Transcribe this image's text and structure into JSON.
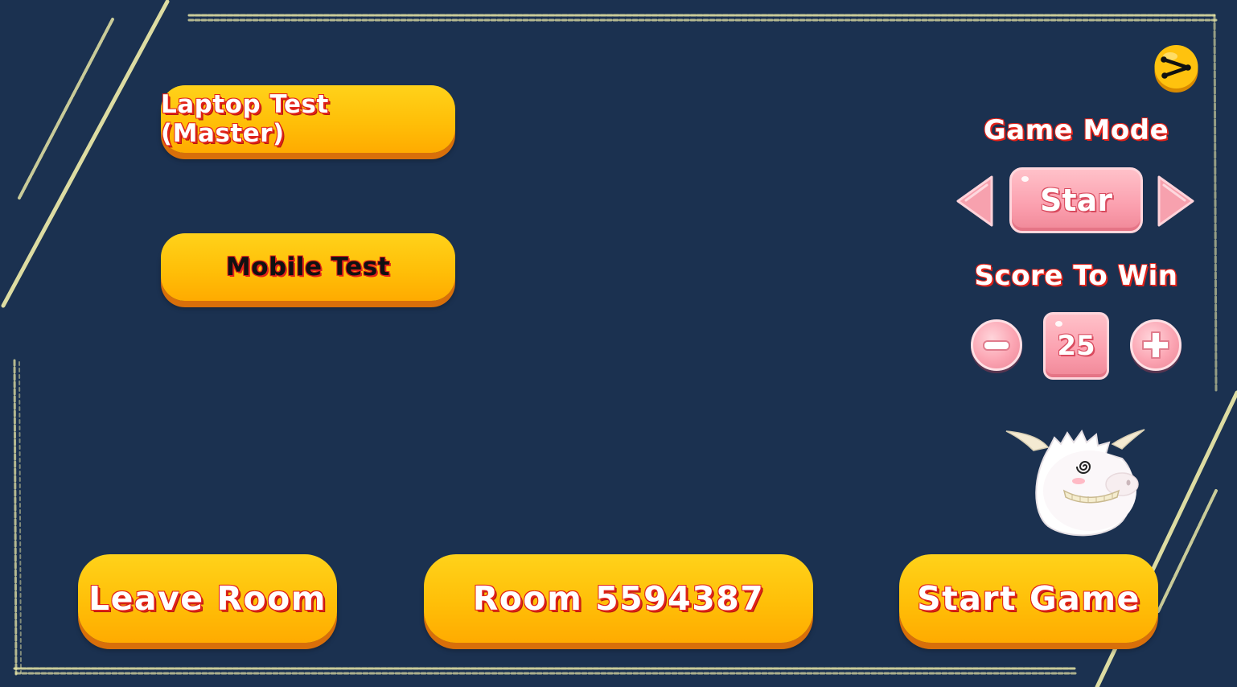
{
  "players": [
    {
      "label": "Laptop Test (Master)",
      "is_master": true
    },
    {
      "label": "Mobile Test",
      "is_master": false
    }
  ],
  "game_mode": {
    "title": "Game Mode",
    "value": "Star"
  },
  "score_to_win": {
    "title": "Score To Win",
    "value": "25"
  },
  "buttons": {
    "leave_room": "Leave Room",
    "room": "Room 5594387",
    "start_game": "Start Game"
  },
  "icons": {
    "share": "share-icon",
    "prev": "arrow-left-icon",
    "next": "arrow-right-icon",
    "minus": "minus-icon",
    "plus": "plus-icon",
    "mascot": "sheep-mascot"
  },
  "colors": {
    "background": "#1b3150",
    "button_yellow": "#ffc20e",
    "button_shadow": "#d86f0a",
    "pink": "#fba4b2",
    "text_outline_red": "#e2231a",
    "chalk": "#e8e6a6"
  }
}
